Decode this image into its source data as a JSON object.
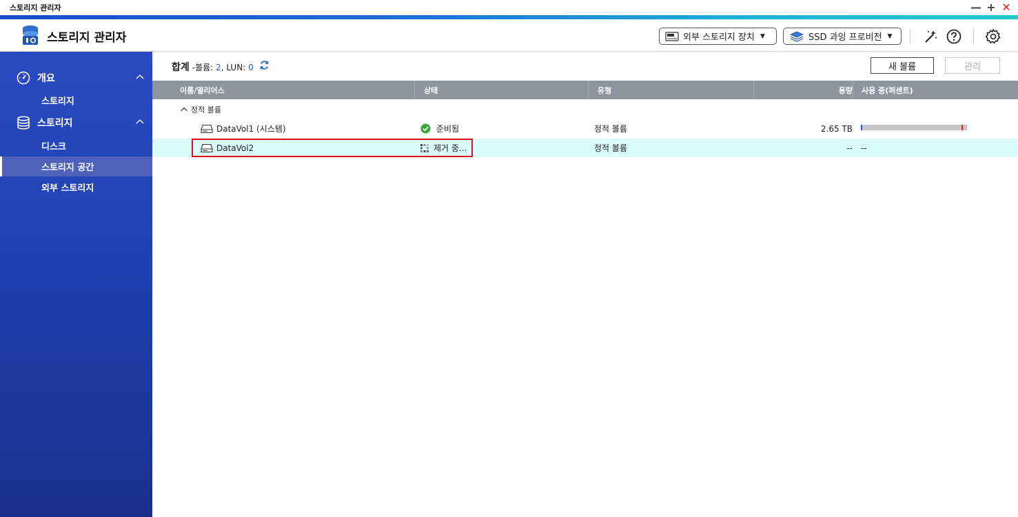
{
  "window": {
    "title": "스토리지 관리자",
    "controls": [
      "minimize",
      "maximize",
      "close"
    ]
  },
  "header": {
    "app_title": "스토리지 관리자",
    "external_storage_label": "외부 스토리지 장치",
    "ssd_profiling_label": "SSD 과잉 프로비전",
    "icons": [
      "app-logo-icon",
      "ssd-icon",
      "ssd-stack-icon",
      "magic-wand-icon",
      "help-icon",
      "settings-icon"
    ]
  },
  "sidebar": {
    "groups": [
      {
        "label": "개요",
        "icon": "gauge-icon",
        "items": [
          {
            "label": "스토리지"
          }
        ]
      },
      {
        "label": "스토리지",
        "icon": "database-icon",
        "items": [
          {
            "label": "디스크"
          },
          {
            "label": "스토리지 공간",
            "active": true
          },
          {
            "label": "외부 스토리지"
          }
        ]
      }
    ]
  },
  "toolbar": {
    "summary_title": "합계",
    "summary_volume_prefix": "-볼륨:",
    "volume_count": "2",
    "summary_lun_prefix": "LUN:",
    "lun_count": "0",
    "new_volume": "새 볼륨",
    "manage": "관리"
  },
  "table": {
    "columns": [
      "이름/앨리어스",
      "상태",
      "유형",
      "용량",
      "사용 중(퍼센트)"
    ],
    "group_label": "정적 볼륨",
    "rows": [
      {
        "name": "DataVol1 (시스템)",
        "status": "준비됨",
        "status_icon": "check-circle-icon",
        "type": "정적 볼륨",
        "capacity": "2.65 TB",
        "usage": "",
        "usage_bar": true
      },
      {
        "name": "DataVol2",
        "status": "제거 중...",
        "status_icon": "progress-dots-icon",
        "type": "정적 볼륨",
        "capacity": "--",
        "usage": "--",
        "selected": true
      }
    ]
  },
  "colors": {
    "accent_blue": "#1f5fd1",
    "sidebar_top": "#2a4bc0",
    "sidebar_bottom": "#1a2f8a",
    "selected_row": "#d9fbfb",
    "highlight_red": "#e0101a",
    "ready_green": "#3aa83a"
  }
}
